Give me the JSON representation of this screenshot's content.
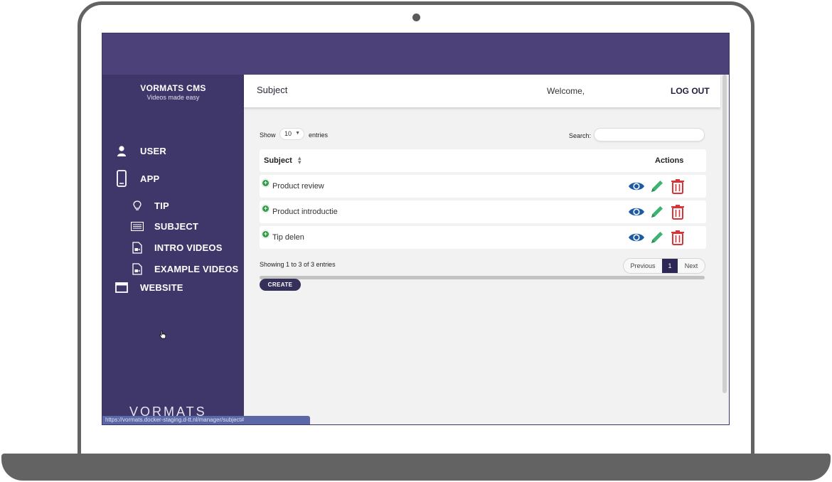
{
  "app": {
    "brand_title": "VORMATS CMS",
    "brand_subtitle": "Videos made easy",
    "brand_footer": "VORMATS",
    "accent_color": "#3f3769"
  },
  "sidebar": {
    "items": [
      {
        "label": "USER",
        "icon": "user-icon"
      },
      {
        "label": "APP",
        "icon": "phone-icon"
      },
      {
        "label": "TIP",
        "icon": "lightbulb-icon"
      },
      {
        "label": "SUBJECT",
        "icon": "list-icon"
      },
      {
        "label": "INTRO VIDEOS",
        "icon": "video-file-icon"
      },
      {
        "label": "EXAMPLE VIDEOS",
        "icon": "video-file-icon"
      },
      {
        "label": "WEBSITE",
        "icon": "browser-window-icon"
      }
    ]
  },
  "header": {
    "title": "Subject",
    "welcome": "Welcome,",
    "logout": "LOG OUT"
  },
  "table_controls": {
    "show_label": "Show",
    "page_length": "10",
    "entries_label": "entries",
    "search_label": "Search:",
    "search_value": ""
  },
  "table": {
    "columns": [
      "Subject",
      "Actions"
    ],
    "rows": [
      {
        "subject": "Product review"
      },
      {
        "subject": "Product introductie"
      },
      {
        "subject": "Tip delen"
      }
    ],
    "action_icons": [
      "eye-icon",
      "pencil-icon",
      "trash-icon"
    ]
  },
  "footer": {
    "info": "Showing 1 to 3 of 3 entries",
    "previous": "Previous",
    "page": "1",
    "next": "Next",
    "create": "CREATE"
  },
  "status_bar": {
    "url": "https://vormats.docker-staging.d-tt.nl/manager/subject#"
  }
}
